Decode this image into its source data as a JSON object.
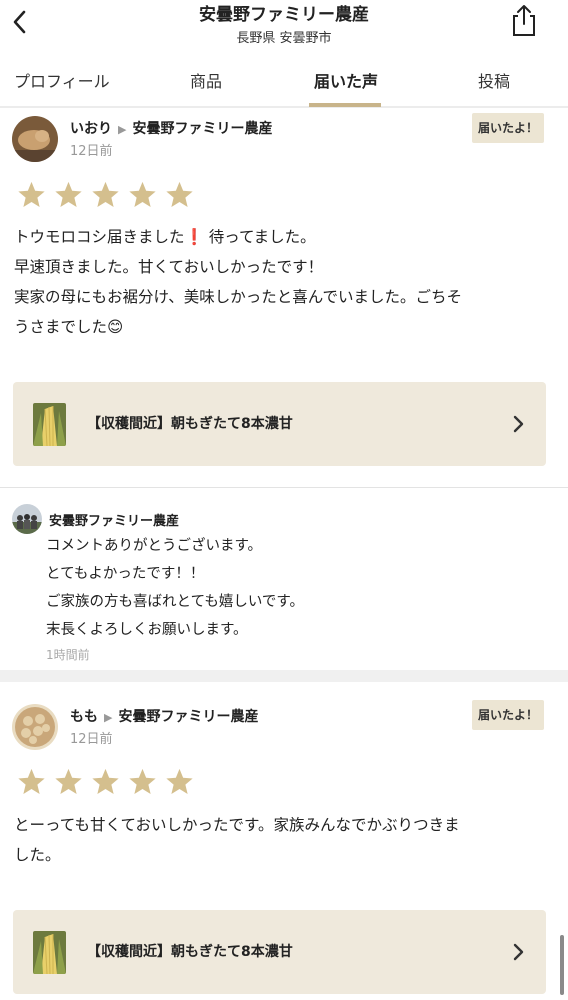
{
  "header": {
    "title": "安曇野ファミリー農産",
    "subtitle": "長野県 安曇野市"
  },
  "tabs": [
    {
      "label": "プロフィール"
    },
    {
      "label": "商品"
    },
    {
      "label": "届いた声",
      "active": true
    },
    {
      "label": "投稿"
    }
  ],
  "reviews": [
    {
      "reviewer": "いおり",
      "farm": "安曇野ファミリー農産",
      "date": "12日前",
      "badge": "届いたよ！",
      "rating": 5,
      "text_lines": [
        "トウモロコシ届きました❗️ 待ってました。",
        "早速頂きました。甘くておいしかったです！",
        "実家の母にもお裾分け、美味しかったと喜んでいました。ごちそ",
        "うさまでした😊"
      ],
      "product": "【収穫間近】朝もぎたて8本濃甘",
      "reply": {
        "name": "安曇野ファミリー農産",
        "lines": [
          "コメントありがとうございます。",
          "とてもよかったです！！",
          "ご家族の方も喜ばれとても嬉しいです。",
          "末長くよろしくお願いします。"
        ],
        "time": "1時間前"
      }
    },
    {
      "reviewer": "もも",
      "farm": "安曇野ファミリー農産",
      "date": "12日前",
      "badge": "届いたよ！",
      "rating": 5,
      "text_lines": [
        "とーっても甘くておいしかったです。家族みんなでかぶりつきま",
        "した。"
      ],
      "product": "【収穫間近】朝もぎたて8本濃甘"
    }
  ],
  "colors": {
    "star": "#d4bf8e",
    "card_bg": "#efe9dc",
    "badge_bg": "#ece5d3",
    "tab_underline": "#c8b48a"
  }
}
